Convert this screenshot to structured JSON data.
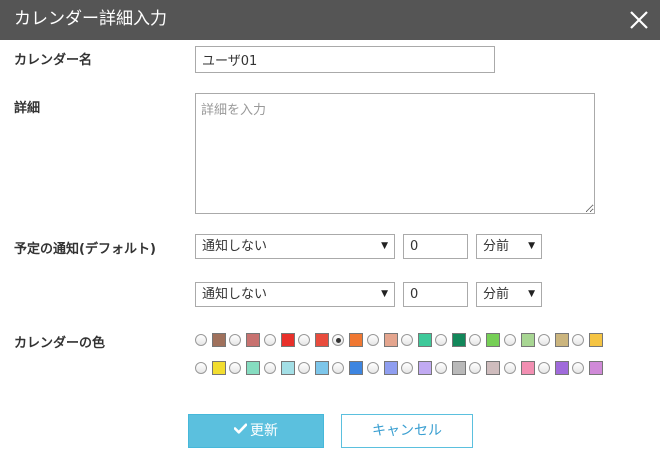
{
  "dialog": {
    "title": "カレンダー詳細入力",
    "close_icon": "close-icon"
  },
  "form": {
    "name_label": "カレンダー名",
    "name_value": "ユーザ01",
    "detail_label": "詳細",
    "detail_placeholder": "詳細を入力",
    "detail_value": "",
    "notify_label": "予定の通知(デフォルト)",
    "notifications": [
      {
        "type": "通知しない",
        "amount": "0",
        "unit": "分前"
      },
      {
        "type": "通知しない",
        "amount": "0",
        "unit": "分前"
      }
    ],
    "color_label": "カレンダーの色",
    "colors": [
      [
        "#a0715c",
        "#c87270",
        "#e8302a",
        "#e84c3d",
        "#f07832",
        "#e4a58e",
        "#3ec99a",
        "#12875a",
        "#76cf56",
        "#a8d693",
        "#cbb57e",
        "#f5c443"
      ],
      [
        "#f2dd30",
        "#86dcc0",
        "#a3dfe6",
        "#7dc6ea",
        "#3d85e0",
        "#8f9ef0",
        "#c1aaf2",
        "#b9b9b9",
        "#cfbcbd",
        "#f28fb2",
        "#a06bdb",
        "#d08ad8"
      ]
    ],
    "selected_color": "#f07832"
  },
  "buttons": {
    "update_label": "更新",
    "update_icon": "check-icon",
    "cancel_label": "キャンセル"
  }
}
